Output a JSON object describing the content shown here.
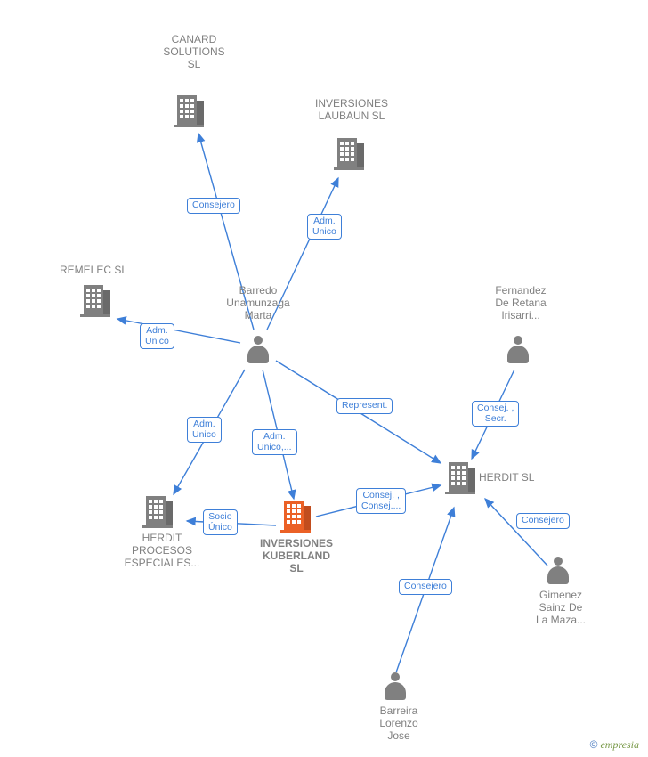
{
  "diagram": {
    "nodes": {
      "canard": {
        "label": "CANARD\nSOLUTIONS\nSL",
        "type": "company",
        "highlight": false
      },
      "laubaun": {
        "label": "INVERSIONES\nLAUBAUN  SL",
        "type": "company",
        "highlight": false
      },
      "remelec": {
        "label": "REMELEC SL",
        "type": "company",
        "highlight": false
      },
      "barredo": {
        "label": "Barredo\nUnamunzaga\nMarta",
        "type": "person"
      },
      "fernandez": {
        "label": "Fernandez\nDe Retana\nIrisarri...",
        "type": "person"
      },
      "herditproc": {
        "label": "HERDIT\nPROCESOS\nESPECIALES...",
        "type": "company",
        "highlight": false
      },
      "kuberland": {
        "label": "INVERSIONES\nKUBERLAND\nSL",
        "type": "company",
        "highlight": true
      },
      "herdit": {
        "label": "HERDIT SL",
        "type": "company",
        "highlight": false
      },
      "gimenez": {
        "label": "Gimenez\nSainz De\nLa Maza...",
        "type": "person"
      },
      "barreira": {
        "label": "Barreira\nLorenzo\nJose",
        "type": "person"
      }
    },
    "edges": {
      "e1": {
        "label": "Consejero"
      },
      "e2": {
        "label": "Adm.\nUnico"
      },
      "e3": {
        "label": "Adm.\nUnico"
      },
      "e4": {
        "label": "Adm.\nUnico"
      },
      "e5": {
        "label": "Adm.\nUnico,..."
      },
      "e6": {
        "label": "Represent."
      },
      "e7": {
        "label": "Consej. ,\nSecr."
      },
      "e8": {
        "label": "Socio\nÚnico"
      },
      "e9": {
        "label": "Consej. ,\nConsej...."
      },
      "e10": {
        "label": "Consejero"
      },
      "e11": {
        "label": "Consejero"
      }
    },
    "footer": {
      "copyright_symbol": "©",
      "brand": "empresia"
    }
  }
}
